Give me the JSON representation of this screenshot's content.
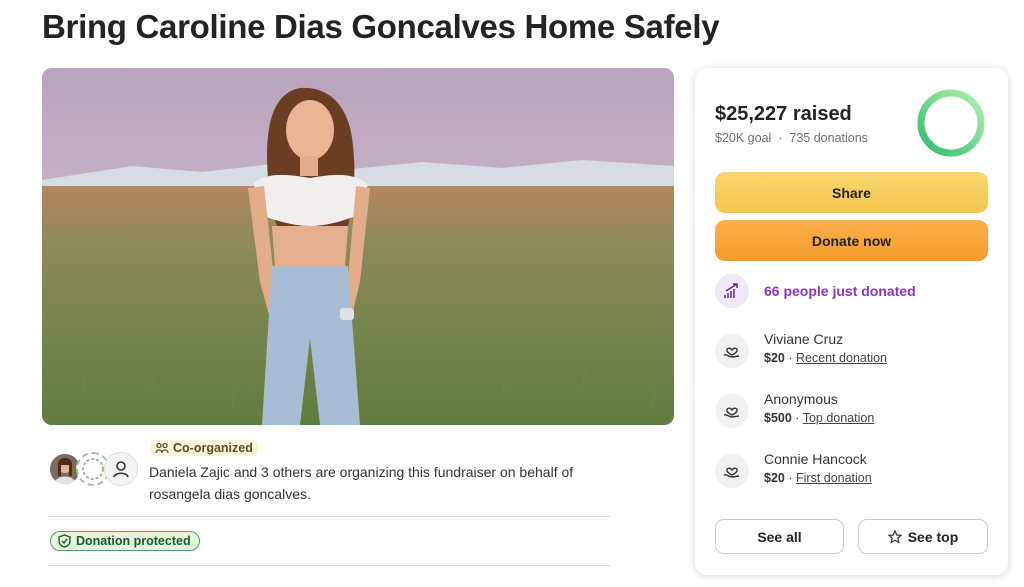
{
  "campaign": {
    "title": "Bring Caroline Dias Goncalves Home Safely"
  },
  "organizer": {
    "badge": "Co-organized",
    "text": "Daniela Zajic and 3 others are organizing this fundraiser on behalf of rosangela dias goncalves."
  },
  "protection": {
    "label": "Donation protected"
  },
  "progress": {
    "raised": "$25,227 raised",
    "goal": "$20K goal",
    "separator": "·",
    "donations": "735 donations",
    "percent_of_goal": 100,
    "ring_color": "#2dbf6c"
  },
  "actions": {
    "share": "Share",
    "donate": "Donate now",
    "see_all": "See all",
    "see_top": "See top"
  },
  "activity": {
    "recent_count": "66 people just donated",
    "accent": "#8c35c4"
  },
  "donors": [
    {
      "name": "Viviane Cruz",
      "amount": "$20",
      "sep": " · ",
      "tag": "Recent donation"
    },
    {
      "name": "Anonymous",
      "amount": "$500",
      "sep": " · ",
      "tag": "Top donation"
    },
    {
      "name": "Connie Hancock",
      "amount": "$20",
      "sep": " · ",
      "tag": "First donation"
    }
  ],
  "colors": {
    "share": "#f5cd5c",
    "donate": "#f8a43a",
    "protected_border": "#4aa84a"
  }
}
